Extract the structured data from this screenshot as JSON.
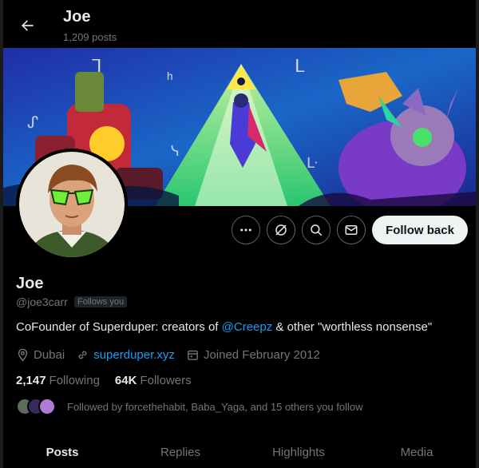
{
  "header": {
    "title": "Joe",
    "post_count": "1,209 posts"
  },
  "profile": {
    "name": "Joe",
    "handle": "@joe3carr",
    "follows_you_badge": "Follows you",
    "bio_prefix": "CoFounder of Superduper: creators of ",
    "bio_mention": "@Creepz",
    "bio_suffix": " & other \"worthless nonsense\"",
    "location": "Dubai",
    "website": "superduper.xyz",
    "joined": "Joined February 2012",
    "following_count": "2,147",
    "following_label": "Following",
    "followers_count": "64K",
    "followers_label": "Followers",
    "followed_by_text": "Followed by forcethehabit, Baba_Yaga, and 15 others you follow"
  },
  "actions": {
    "follow_label": "Follow back"
  },
  "tabs": [
    {
      "label": "Posts"
    },
    {
      "label": "Replies"
    },
    {
      "label": "Highlights"
    },
    {
      "label": "Media"
    }
  ],
  "colors": {
    "accent": "#1d9bf0",
    "muted": "#71767b",
    "text": "#e7e9ea",
    "bg": "#000000"
  },
  "icons": [
    "back-arrow-icon",
    "more-icon",
    "grok-icon",
    "search-icon",
    "mail-icon",
    "location-icon",
    "link-icon",
    "calendar-icon"
  ]
}
